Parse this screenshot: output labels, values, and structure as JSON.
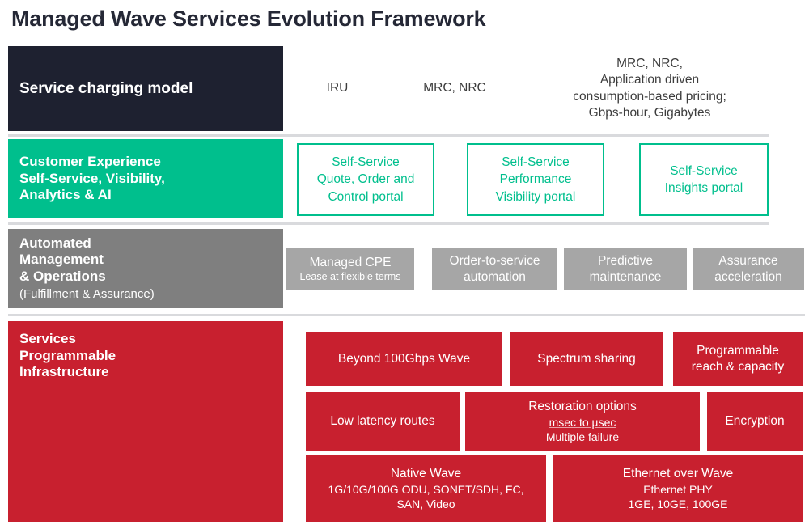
{
  "page": {
    "title": "Managed Wave Services Evolution Framework"
  },
  "colors": {
    "navy": "#1e2130",
    "green": "#00bf8d",
    "gray": "#7f7f7f",
    "gray_box": "#a6a6a6",
    "red": "#c8202f",
    "divider": "#d9dadd",
    "title_text": "#252836"
  },
  "rows": {
    "charging": {
      "label": "Service charging model",
      "cells": [
        {
          "text": "IRU"
        },
        {
          "text": "MRC, NRC"
        },
        {
          "text": "MRC, NRC,\nApplication  driven\nconsumption-based pricing;\nGbps-hour, Gigabytes"
        }
      ]
    },
    "customer_experience": {
      "label_line1": "Customer Experience",
      "label_line2": "Self-Service, Visibility,",
      "label_line3": "Analytics & AI",
      "boxes": [
        {
          "text": "Self-Service\nQuote, Order and\nControl portal"
        },
        {
          "text": "Self-Service\nPerformance\nVisibility portal"
        },
        {
          "text": "Self-Service\nInsights portal"
        }
      ]
    },
    "automated_management": {
      "label_line1": "Automated",
      "label_line2": "Management",
      "label_line3": "& Operations",
      "label_sub": "(Fulfillment & Assurance)",
      "boxes": [
        {
          "main": "Managed CPE",
          "sub": "Lease at flexible terms"
        },
        {
          "main": "Order-to-service\nautomation",
          "sub": ""
        },
        {
          "main": "Predictive\nmaintenance",
          "sub": ""
        },
        {
          "main": "Assurance\nacceleration",
          "sub": ""
        }
      ]
    },
    "services": {
      "label_line1": "Services",
      "label_line2": "Programmable",
      "label_line3": "Infrastructure",
      "boxes": [
        {
          "main": "Beyond 100Gbps Wave",
          "sub": "",
          "sub2": ""
        },
        {
          "main": "Spectrum sharing",
          "sub": "",
          "sub2": ""
        },
        {
          "main": "Programmable\nreach & capacity",
          "sub": "",
          "sub2": ""
        },
        {
          "main": "Low latency routes",
          "sub": "",
          "sub2": ""
        },
        {
          "main": "Restoration options",
          "sub": "msec to µsec",
          "sub2": "Multiple failure"
        },
        {
          "main": "Encryption",
          "sub": "",
          "sub2": ""
        },
        {
          "main": "Native Wave",
          "sub": "1G/10G/100G ODU, SONET/SDH, FC,",
          "sub2": "SAN, Video"
        },
        {
          "main": "Ethernet over Wave",
          "sub": "Ethernet PHY",
          "sub2": "1GE, 10GE, 100GE"
        }
      ]
    }
  }
}
